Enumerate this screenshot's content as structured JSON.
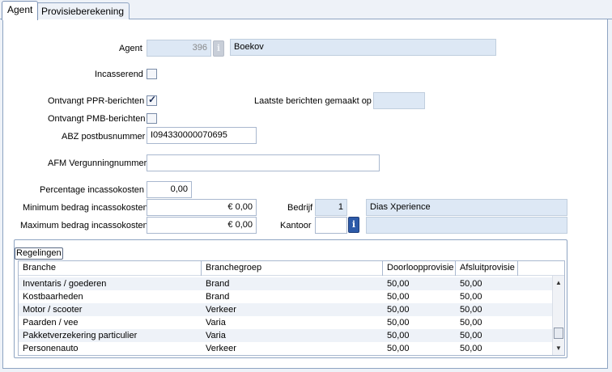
{
  "tabs": [
    {
      "label": "Agent"
    },
    {
      "label": "Provisieberekening"
    }
  ],
  "form": {
    "agent_label": "Agent",
    "agent_code": "396",
    "agent_name": "Boekov",
    "incasserend_label": "Incasserend",
    "incasserend_checked": false,
    "ppr_label": "Ontvangt PPR-berichten",
    "ppr_checked": true,
    "pmb_label": "Ontvangt PMB-berichten",
    "pmb_checked": false,
    "laatste_label": "Laatste berichten gemaakt op",
    "laatste_value": "",
    "abz_label": "ABZ postbusnummer",
    "abz_value": "I094330000070695",
    "afm_label": "AFM Vergunningnummer",
    "afm_value": "",
    "perc_label": "Percentage incassokosten",
    "perc_value": "0,00",
    "min_label": "Minimum bedrag incassokosten",
    "min_value": "€ 0,00",
    "max_label": "Maximum bedrag incassokosten",
    "max_value": "€ 0,00",
    "bedrijf_label": "Bedrijf",
    "bedrijf_code": "1",
    "bedrijf_name": "Dias Xperience",
    "kantoor_label": "Kantoor",
    "kantoor_code": "",
    "kantoor_name": ""
  },
  "regelingen": {
    "group_label": "Regelingen",
    "columns": [
      "Branche",
      "Branchegroep",
      "Doorloopprovisie",
      "Afsluitprovisie"
    ],
    "rows": [
      [
        "Inventaris / goederen",
        "Brand",
        "50,00",
        "50,00"
      ],
      [
        "Kostbaarheden",
        "Brand",
        "50,00",
        "50,00"
      ],
      [
        "Motor / scooter",
        "Verkeer",
        "50,00",
        "50,00"
      ],
      [
        "Paarden / vee",
        "Varia",
        "50,00",
        "50,00"
      ],
      [
        "Pakketverzekering particulier",
        "Varia",
        "50,00",
        "50,00"
      ],
      [
        "Personenauto",
        "Verkeer",
        "50,00",
        "50,00"
      ]
    ]
  },
  "icons": {
    "info": "i",
    "scroll_up": "▲",
    "scroll_down": "▼"
  }
}
